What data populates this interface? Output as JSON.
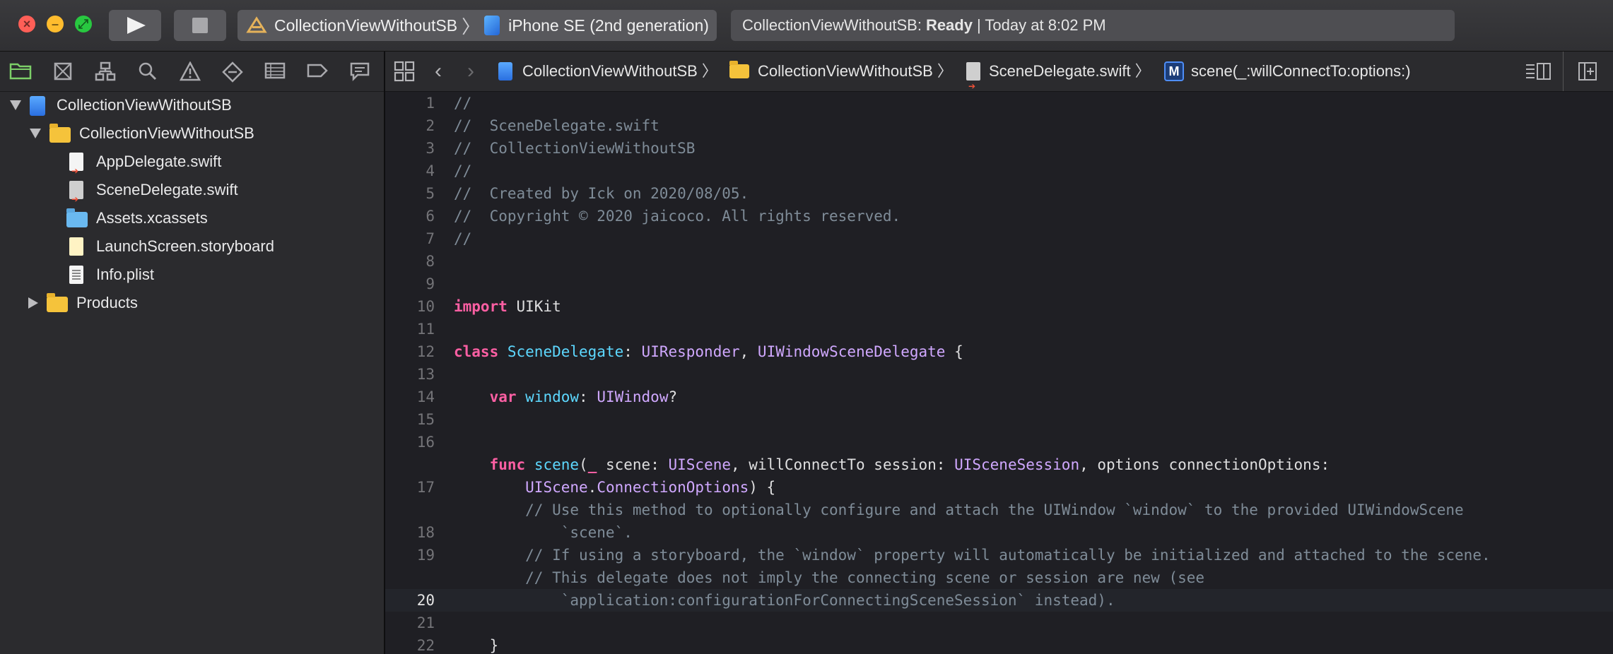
{
  "toolbar": {
    "scheme_project": "CollectionViewWithoutSB",
    "scheme_device": "iPhone SE (2nd generation)",
    "activity_prefix": "CollectionViewWithoutSB:",
    "activity_status": "Ready",
    "activity_time": "| Today at 8:02 PM"
  },
  "navigator": {
    "tree": [
      {
        "label": "CollectionViewWithoutSB",
        "kind": "project"
      },
      {
        "label": "CollectionViewWithoutSB",
        "kind": "folder"
      },
      {
        "label": "AppDelegate.swift",
        "kind": "swift"
      },
      {
        "label": "SceneDelegate.swift",
        "kind": "swift"
      },
      {
        "label": "Assets.xcassets",
        "kind": "assets"
      },
      {
        "label": "LaunchScreen.storyboard",
        "kind": "storyboard"
      },
      {
        "label": "Info.plist",
        "kind": "plist"
      },
      {
        "label": "Products",
        "kind": "folder"
      }
    ]
  },
  "jumpbar": {
    "project": "CollectionViewWithoutSB",
    "folder": "CollectionViewWithoutSB",
    "file": "SceneDelegate.swift",
    "symbol": "scene(_:willConnectTo:options:)"
  },
  "editor": {
    "current_line": "20",
    "line_numbers": [
      "1",
      "2",
      "3",
      "4",
      "5",
      "6",
      "7",
      "8",
      "9",
      "10",
      "11",
      "12",
      "13",
      "14",
      "15",
      "16",
      "",
      "17",
      "",
      "18",
      "19",
      "",
      "20",
      "21",
      "22"
    ],
    "comments": {
      "l1": "//",
      "l2": "//  SceneDelegate.swift",
      "l3": "//  CollectionViewWithoutSB",
      "l4": "//",
      "l5": "//  Created by Ick on 2020/08/05.",
      "l6": "//  Copyright © 2020 jaicoco. All rights reserved.",
      "l7": "//",
      "l17a": "// Use this method to optionally configure and attach the UIWindow `window` to the provided UIWindowScene",
      "l17b": "`scene`.",
      "l18": "// If using a storyboard, the `window` property will automatically be initialized and attached to the scene.",
      "l19a": "// This delegate does not imply the connecting scene or session are new (see",
      "l19b": "`application:configurationForConnectingSceneSession` instead)."
    },
    "tokens": {
      "import_kw": "import",
      "uikit": " UIKit",
      "class_kw": "class",
      "scene_delegate": "SceneDelegate",
      "colon_space": ": ",
      "uiresponder": "UIResponder",
      "comma_space": ", ",
      "uiwindowscenedelegate": "UIWindowSceneDelegate",
      "brace_open": " {",
      "var_kw": "var",
      "window": "window",
      "uiwindow": "UIWindow",
      "question": "?",
      "func_kw": "func",
      "scene_fn": "scene",
      "paren_open": "(",
      "underscore": "_",
      "scene_param": " scene: ",
      "uiscene": "UIScene",
      "will_connect": ", willConnectTo session: ",
      "uiscenesession": "UISceneSession",
      "options_label": ", options connectionOptions:",
      "uiscene2": "UIScene",
      "dot": ".",
      "connection_options": "ConnectionOptions",
      "paren_close_brace": ") {",
      "brace_close": "}"
    }
  }
}
